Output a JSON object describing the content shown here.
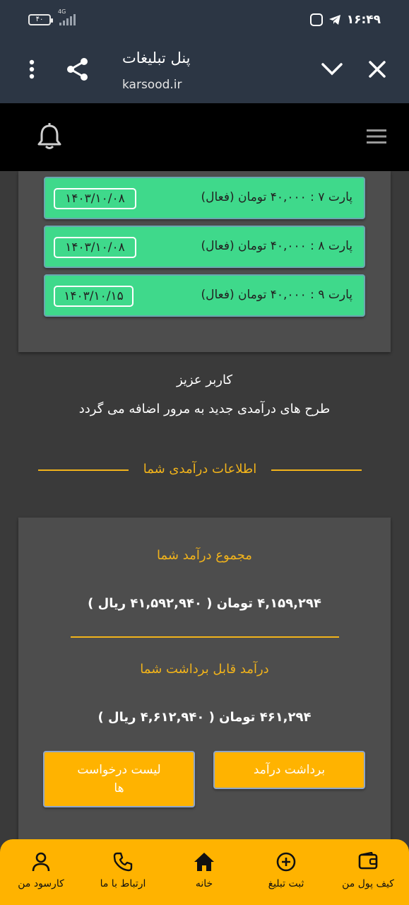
{
  "status_bar": {
    "battery": "۴۰",
    "network": "4G",
    "time": "۱۶:۴۹",
    "icons": [
      "vpn-app-icon",
      "telegram-icon"
    ]
  },
  "browser": {
    "title": "پنل تبلیغات",
    "url": "karsood.ir",
    "icons": [
      "more-vert-icon",
      "share-icon",
      "chevron-down-icon",
      "close-icon"
    ]
  },
  "site_header": {
    "icons": [
      "bell-icon",
      "menu-icon"
    ]
  },
  "parts": [
    {
      "label": "پارت ۷ : ۴۰,۰۰۰ تومان (فعال)",
      "date": "۱۴۰۳/۱۰/۰۸"
    },
    {
      "label": "پارت ۸ : ۴۰,۰۰۰ تومان (فعال)",
      "date": "۱۴۰۳/۱۰/۰۸"
    },
    {
      "label": "پارت ۹ : ۴۰,۰۰۰ تومان (فعال)",
      "date": "۱۴۰۳/۱۰/۱۵"
    }
  ],
  "notice": {
    "line1": "کاربر عزیز",
    "line2": "طرح های درآمدی جدید به مرور اضافه می گردد"
  },
  "income_section_title": "اطلاعات درآمدی شما",
  "income": {
    "total_label": "مجموع درآمد شما",
    "total_value": "۴,۱۵۹,۲۹۴ تومان ( ۴۱,۵۹۲,۹۴۰ ریال )",
    "withdrawable_label": "درآمد قابل برداشت شما",
    "withdrawable_value": "۴۶۱,۲۹۴ تومان ( ۴,۶۱۲,۹۴۰ ریال )",
    "withdraw_button": "برداشت درآمد",
    "requests_button": "لیست درخواست ها"
  },
  "bottom_nav": [
    {
      "label": "کیف پول من",
      "icon": "wallet-icon"
    },
    {
      "label": "ثبت تبلیغ",
      "icon": "plus-circle-icon"
    },
    {
      "label": "خانه",
      "icon": "home-icon"
    },
    {
      "label": "ارتباط با ما",
      "icon": "phone-icon"
    },
    {
      "label": "کارسود من",
      "icon": "user-icon"
    }
  ],
  "colors": {
    "accent": "#ffb300",
    "gold_text": "#f1b31b",
    "active_part": "#3fd98b",
    "header_bg": "#2c3644",
    "page_bg": "#3a3a3a",
    "card_bg": "#4d4d4d"
  }
}
